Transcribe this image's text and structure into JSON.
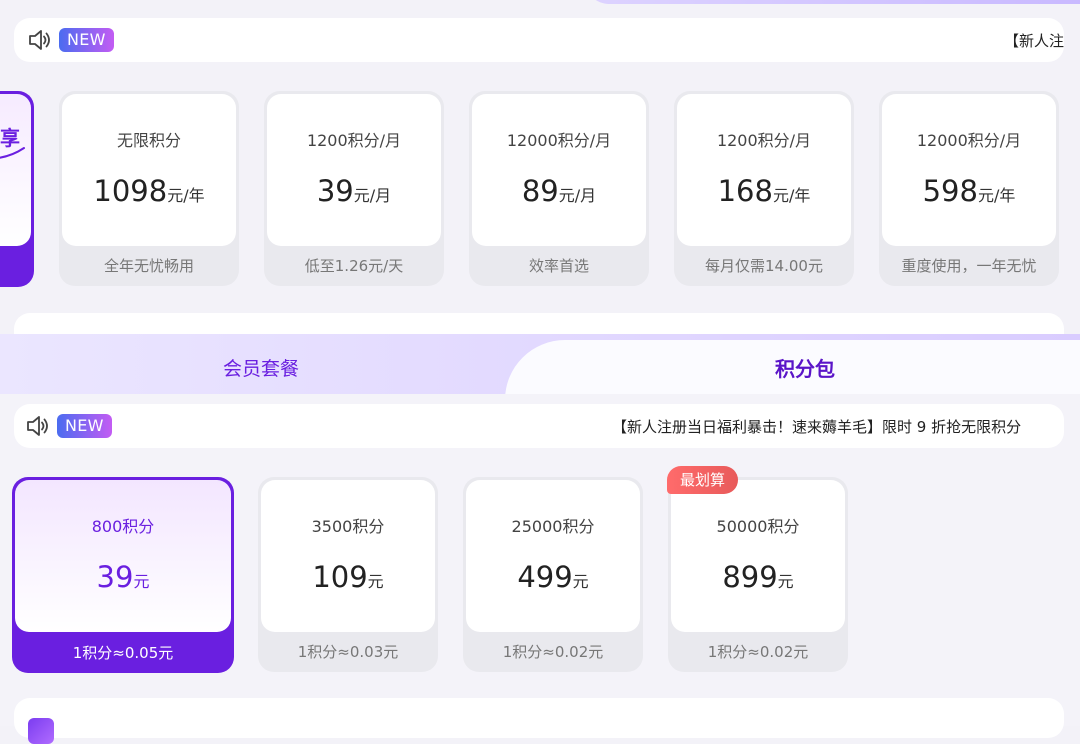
{
  "top_section": {
    "badge": "NEW",
    "notice": "【新人注",
    "partial_card_text": "享",
    "cards": [
      {
        "title": "无限积分",
        "price": "1098",
        "unit": "元/年",
        "footnote": "全年无忧畅用"
      },
      {
        "title": "1200积分/月",
        "price": "39",
        "unit": "元/月",
        "footnote": "低至1.26元/天"
      },
      {
        "title": "12000积分/月",
        "price": "89",
        "unit": "元/月",
        "footnote": "效率首选"
      },
      {
        "title": "1200积分/月",
        "price": "168",
        "unit": "元/年",
        "footnote": "每月仅需14.00元"
      },
      {
        "title": "12000积分/月",
        "price": "598",
        "unit": "元/年",
        "footnote": "重度使用，一年无忧"
      }
    ]
  },
  "tabs": [
    {
      "label": "会员套餐",
      "active": false
    },
    {
      "label": "积分包",
      "active": true
    }
  ],
  "bottom_section": {
    "badge": "NEW",
    "notice": "【新人注册当日福利暴击！速来薅羊毛】限时 9 折抢无限积分",
    "best_value_tag": "最划算",
    "packs": [
      {
        "title": "800积分",
        "price": "39",
        "unit": "元",
        "footnote": "1积分≈0.05元",
        "selected": true
      },
      {
        "title": "3500积分",
        "price": "109",
        "unit": "元",
        "footnote": "1积分≈0.03元",
        "selected": false
      },
      {
        "title": "25000积分",
        "price": "499",
        "unit": "元",
        "footnote": "1积分≈0.02元",
        "selected": false
      },
      {
        "title": "50000积分",
        "price": "899",
        "unit": "元",
        "footnote": "1积分≈0.02元",
        "selected": false
      }
    ]
  },
  "colors": {
    "accent": "#6a1fe0",
    "badge_gradient_start": "#4b6cf0",
    "badge_gradient_end": "#c35cf3",
    "tag_red": "#ff6b6b",
    "card_footer_gray": "#e9e9ee"
  }
}
